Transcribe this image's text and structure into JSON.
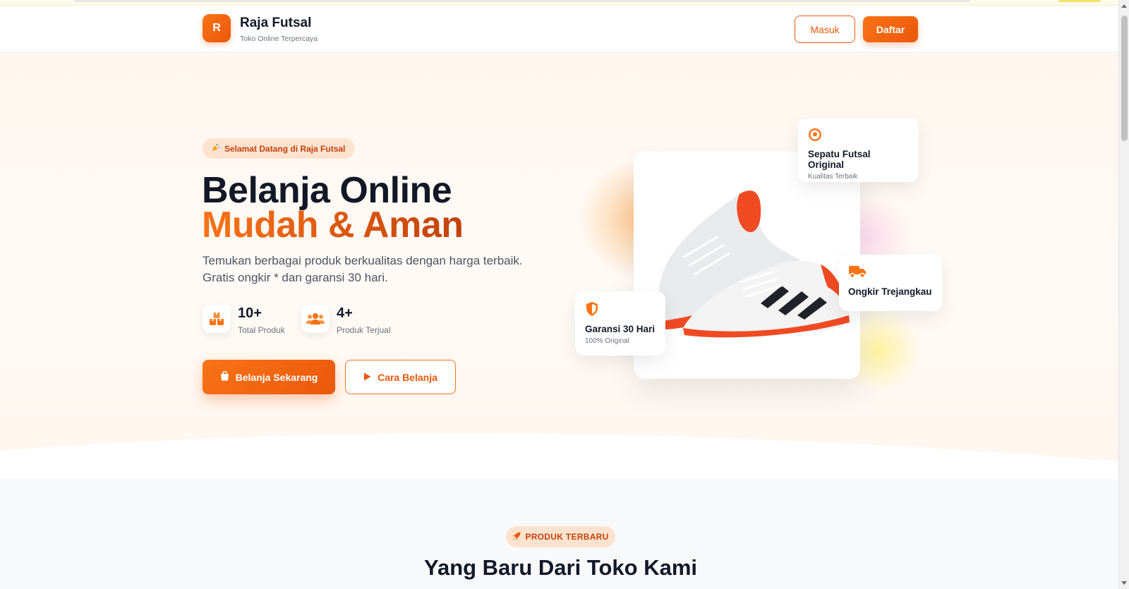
{
  "header": {
    "logo_letter": "R",
    "brand_name": "Raja Futsal",
    "brand_tagline": "Toko Online Terpercaya",
    "login_label": "Masuk",
    "register_label": "Daftar"
  },
  "hero": {
    "badge_icon": "party-popper-icon",
    "badge_label": "Selamat Datang di Raja Futsal",
    "headline_line1": "Belanja Online",
    "headline_line2": "Mudah & Aman",
    "description": "Temukan berbagai produk berkualitas dengan harga terbaik. Gratis ongkir * dan garansi 30 hari.",
    "stats": [
      {
        "icon": "boxes-icon",
        "value": "10+",
        "label": "Total Produk"
      },
      {
        "icon": "users-icon",
        "value": "4+",
        "label": "Produk Terjual"
      }
    ],
    "primary_cta": "Belanja Sekarang",
    "secondary_cta": "Cara Belanja",
    "product_image": "futsal-shoes-image",
    "feature_cards": [
      {
        "icon": "soccer-ball-icon",
        "title": "Sepatu Futsal Original",
        "subtitle": "Kualitas Terbaik"
      },
      {
        "icon": "shield-icon",
        "title": "Garansi 30 Hari",
        "subtitle": "100% Original"
      },
      {
        "icon": "truck-icon",
        "title": "Ongkir Trejangkau",
        "subtitle": ""
      }
    ]
  },
  "latest_section": {
    "badge_icon": "rocket-icon",
    "badge_label": "PRODUK TERBARU",
    "title": "Yang Baru Dari Toko Kami"
  },
  "colors": {
    "accent": "#f97316",
    "accent_dark": "#ea580c",
    "text_dark": "#111827",
    "text_muted": "#6b7280"
  }
}
